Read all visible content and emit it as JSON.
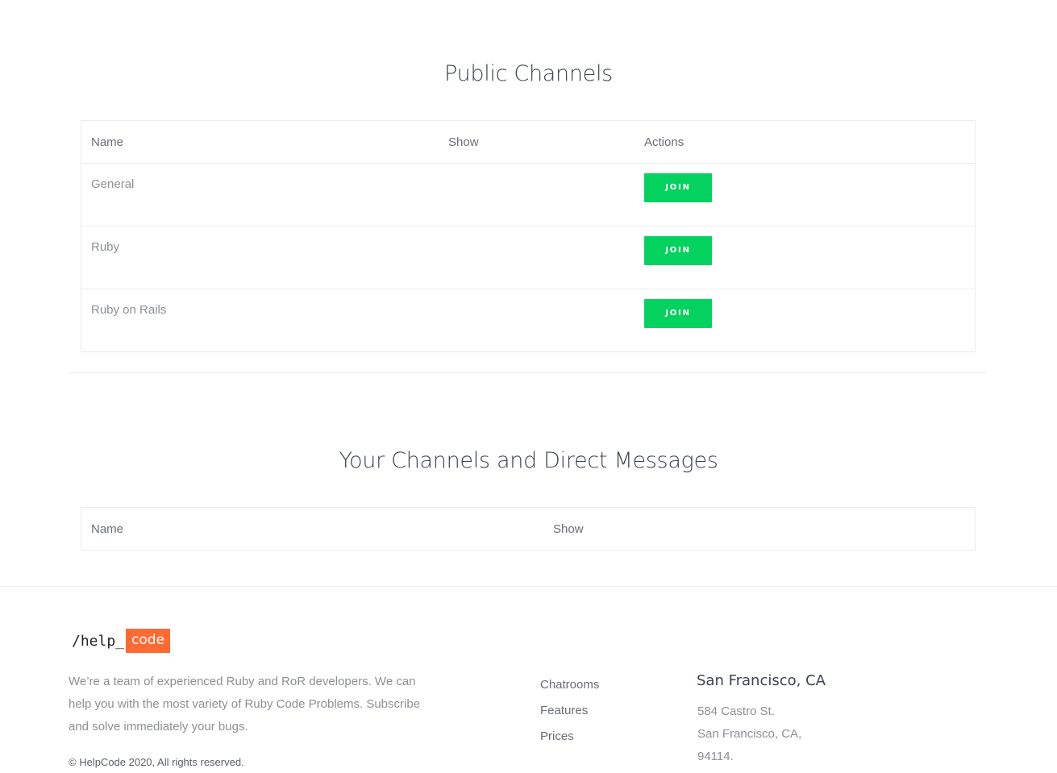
{
  "public_channels": {
    "title": "Public Channels",
    "columns": [
      "Name",
      "Show",
      "Actions"
    ],
    "rows": [
      {
        "name": "General",
        "action": "JOIN"
      },
      {
        "name": "Ruby",
        "action": "JOIN"
      },
      {
        "name": "Ruby on Rails",
        "action": "JOIN"
      }
    ]
  },
  "your_channels": {
    "title": "Your Channels and Direct Messages",
    "columns": [
      "Name",
      "Show"
    ]
  },
  "footer": {
    "logo_prefix": "/help_",
    "logo_suffix": "code",
    "about": "We’re a team of experienced Ruby and RoR developers. We can help you with the most variety of Ruby Code Problems. Subscribe and solve immediately your bugs.",
    "copyright": "© HelpCode 2020, All rights reserved.",
    "links": [
      "Chatrooms",
      "Features",
      "Prices"
    ],
    "city": "San Francisco, CA",
    "address": [
      "584 Castro St.",
      "San Francisco, CA,",
      "94114."
    ]
  },
  "colors": {
    "join_button": "#04d25f",
    "logo_accent": "#ff6a33",
    "heading": "#3d4351"
  }
}
